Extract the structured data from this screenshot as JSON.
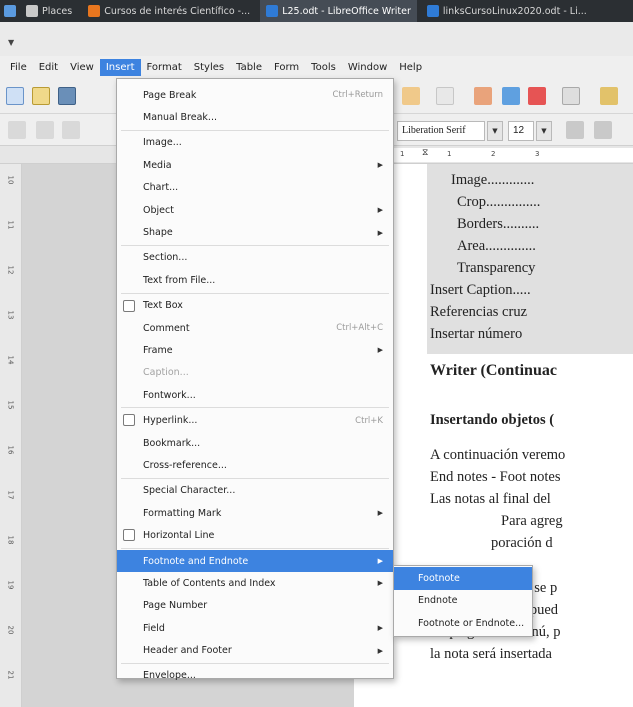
{
  "taskbar": {
    "items": [
      {
        "label": "Places",
        "color": "#c9c9c9"
      },
      {
        "label": "Cursos de interés Científico -...",
        "color": "#e8761f"
      },
      {
        "label": "L25.odt - LibreOffice Writer",
        "color": "#2f7bd6"
      },
      {
        "label": "linksCursoLinux2020.odt - Li...",
        "color": "#2f7bd6"
      }
    ]
  },
  "menubar": {
    "items": [
      "File",
      "Edit",
      "View",
      "Insert",
      "Format",
      "Styles",
      "Table",
      "Form",
      "Tools",
      "Window",
      "Help"
    ]
  },
  "toolbar": {
    "font_name": "Liberation Serif",
    "font_size": "12"
  },
  "ruler": {
    "h_ticks": [
      "1",
      "1",
      "2",
      "3"
    ],
    "v_ticks": [
      "10",
      "11",
      "12",
      "13",
      "14",
      "15",
      "16",
      "17",
      "18",
      "19",
      "20",
      "21"
    ]
  },
  "insert_menu": {
    "items": [
      {
        "label": "Page Break",
        "shortcut": "Ctrl+Return"
      },
      {
        "label": "Manual Break..."
      },
      {
        "sep": true
      },
      {
        "label": "Image..."
      },
      {
        "label": "Media",
        "submenu": true
      },
      {
        "label": "Chart..."
      },
      {
        "label": "Object",
        "submenu": true
      },
      {
        "label": "Shape",
        "submenu": true
      },
      {
        "sep": true
      },
      {
        "label": "Section..."
      },
      {
        "label": "Text from File..."
      },
      {
        "sep": true
      },
      {
        "label": "Text Box",
        "check": true
      },
      {
        "label": "Comment",
        "shortcut": "Ctrl+Alt+C"
      },
      {
        "label": "Frame",
        "submenu": true
      },
      {
        "label": "Caption...",
        "disabled": true
      },
      {
        "label": "Fontwork..."
      },
      {
        "sep": true
      },
      {
        "label": "Hyperlink...",
        "shortcut": "Ctrl+K",
        "check": true
      },
      {
        "label": "Bookmark..."
      },
      {
        "label": "Cross-reference..."
      },
      {
        "sep": true
      },
      {
        "label": "Special Character..."
      },
      {
        "label": "Formatting Mark",
        "submenu": true
      },
      {
        "label": "Horizontal Line",
        "check": true
      },
      {
        "sep": true
      },
      {
        "label": "Footnote and Endnote",
        "submenu": true,
        "highlighted": true
      },
      {
        "label": "Table of Contents and Index",
        "submenu": true
      },
      {
        "label": "Page Number"
      },
      {
        "label": "Field",
        "submenu": true
      },
      {
        "label": "Header and Footer",
        "submenu": true
      },
      {
        "sep": true
      },
      {
        "label": "Envelope..."
      }
    ]
  },
  "submenu": {
    "items": [
      {
        "label": "Footnote",
        "highlighted": true
      },
      {
        "label": "Endnote"
      },
      {
        "label": "Footnote or Endnote..."
      }
    ]
  },
  "document": {
    "lines": [
      {
        "text": "Image.............",
        "indent": 2
      },
      {
        "text": "Crop...............",
        "indent": 3
      },
      {
        "text": "Borders..........",
        "indent": 3
      },
      {
        "text": "Area..............",
        "indent": 3
      },
      {
        "text": "Transparency",
        "indent": 3
      },
      {
        "text": "Insert Caption.....",
        "indent": 1
      },
      {
        "text": "Referencias cruz",
        "indent": 1
      },
      {
        "text": "Insertar número",
        "indent": 1
      },
      {
        "text": "Writer (Continuac",
        "style": "heading"
      },
      {
        "text": "Insertando objetos (",
        "style": "sub"
      },
      {
        "text": "A continuación veremo"
      },
      {
        "text": "End notes - Foot notes"
      },
      {
        "text": "Las notas al final del"
      },
      {
        "text": "Para agreg"
      },
      {
        "text": "poración d"
      },
      {
        "text": "Pra insertar notas se p"
      },
      {
        "text": "siempre también pued"
      },
      {
        "text": "desplegará un menú, p"
      },
      {
        "text": "la nota será insertada"
      }
    ]
  }
}
